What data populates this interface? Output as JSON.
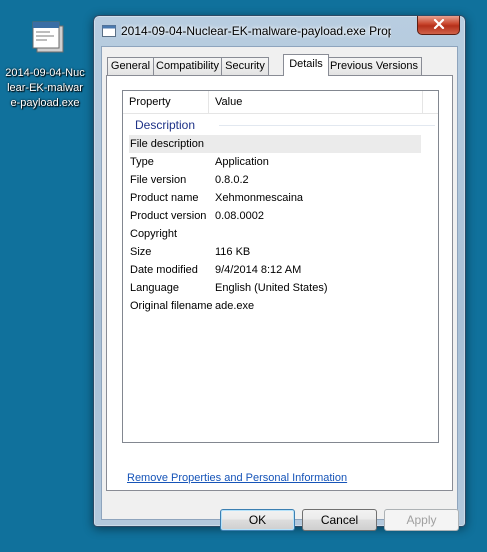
{
  "desktop": {
    "icon_label": "2014-09-04-Nuclear-EK-malware-payload.exe",
    "icon_name": "file-icon"
  },
  "window": {
    "title": "2014-09-04-Nuclear-EK-malware-payload.exe Proper...",
    "title_icon": "document-icon",
    "close_icon": "close-icon"
  },
  "tabs": [
    {
      "label": "General",
      "active": false
    },
    {
      "label": "Compatibility",
      "active": false
    },
    {
      "label": "Security",
      "active": false
    },
    {
      "label": "Details",
      "active": true
    },
    {
      "label": "Previous Versions",
      "active": false
    }
  ],
  "details": {
    "columns": [
      "Property",
      "Value"
    ],
    "group": "Description",
    "rows": [
      {
        "name": "File description",
        "value": ""
      },
      {
        "name": "Type",
        "value": "Application"
      },
      {
        "name": "File version",
        "value": "0.8.0.2"
      },
      {
        "name": "Product name",
        "value": "Xehmonmescaina"
      },
      {
        "name": "Product version",
        "value": "0.08.0002"
      },
      {
        "name": "Copyright",
        "value": ""
      },
      {
        "name": "Size",
        "value": "116 KB"
      },
      {
        "name": "Date modified",
        "value": "9/4/2014 8:12 AM"
      },
      {
        "name": "Language",
        "value": "English (United States)"
      },
      {
        "name": "Original filename",
        "value": "ade.exe"
      }
    ]
  },
  "link_text": "Remove Properties and Personal Information",
  "buttons": {
    "ok": "OK",
    "cancel": "Cancel",
    "apply": "Apply"
  },
  "colors": {
    "desktop": "#10719c",
    "link": "#1654b8",
    "group_header": "#1e3287"
  }
}
